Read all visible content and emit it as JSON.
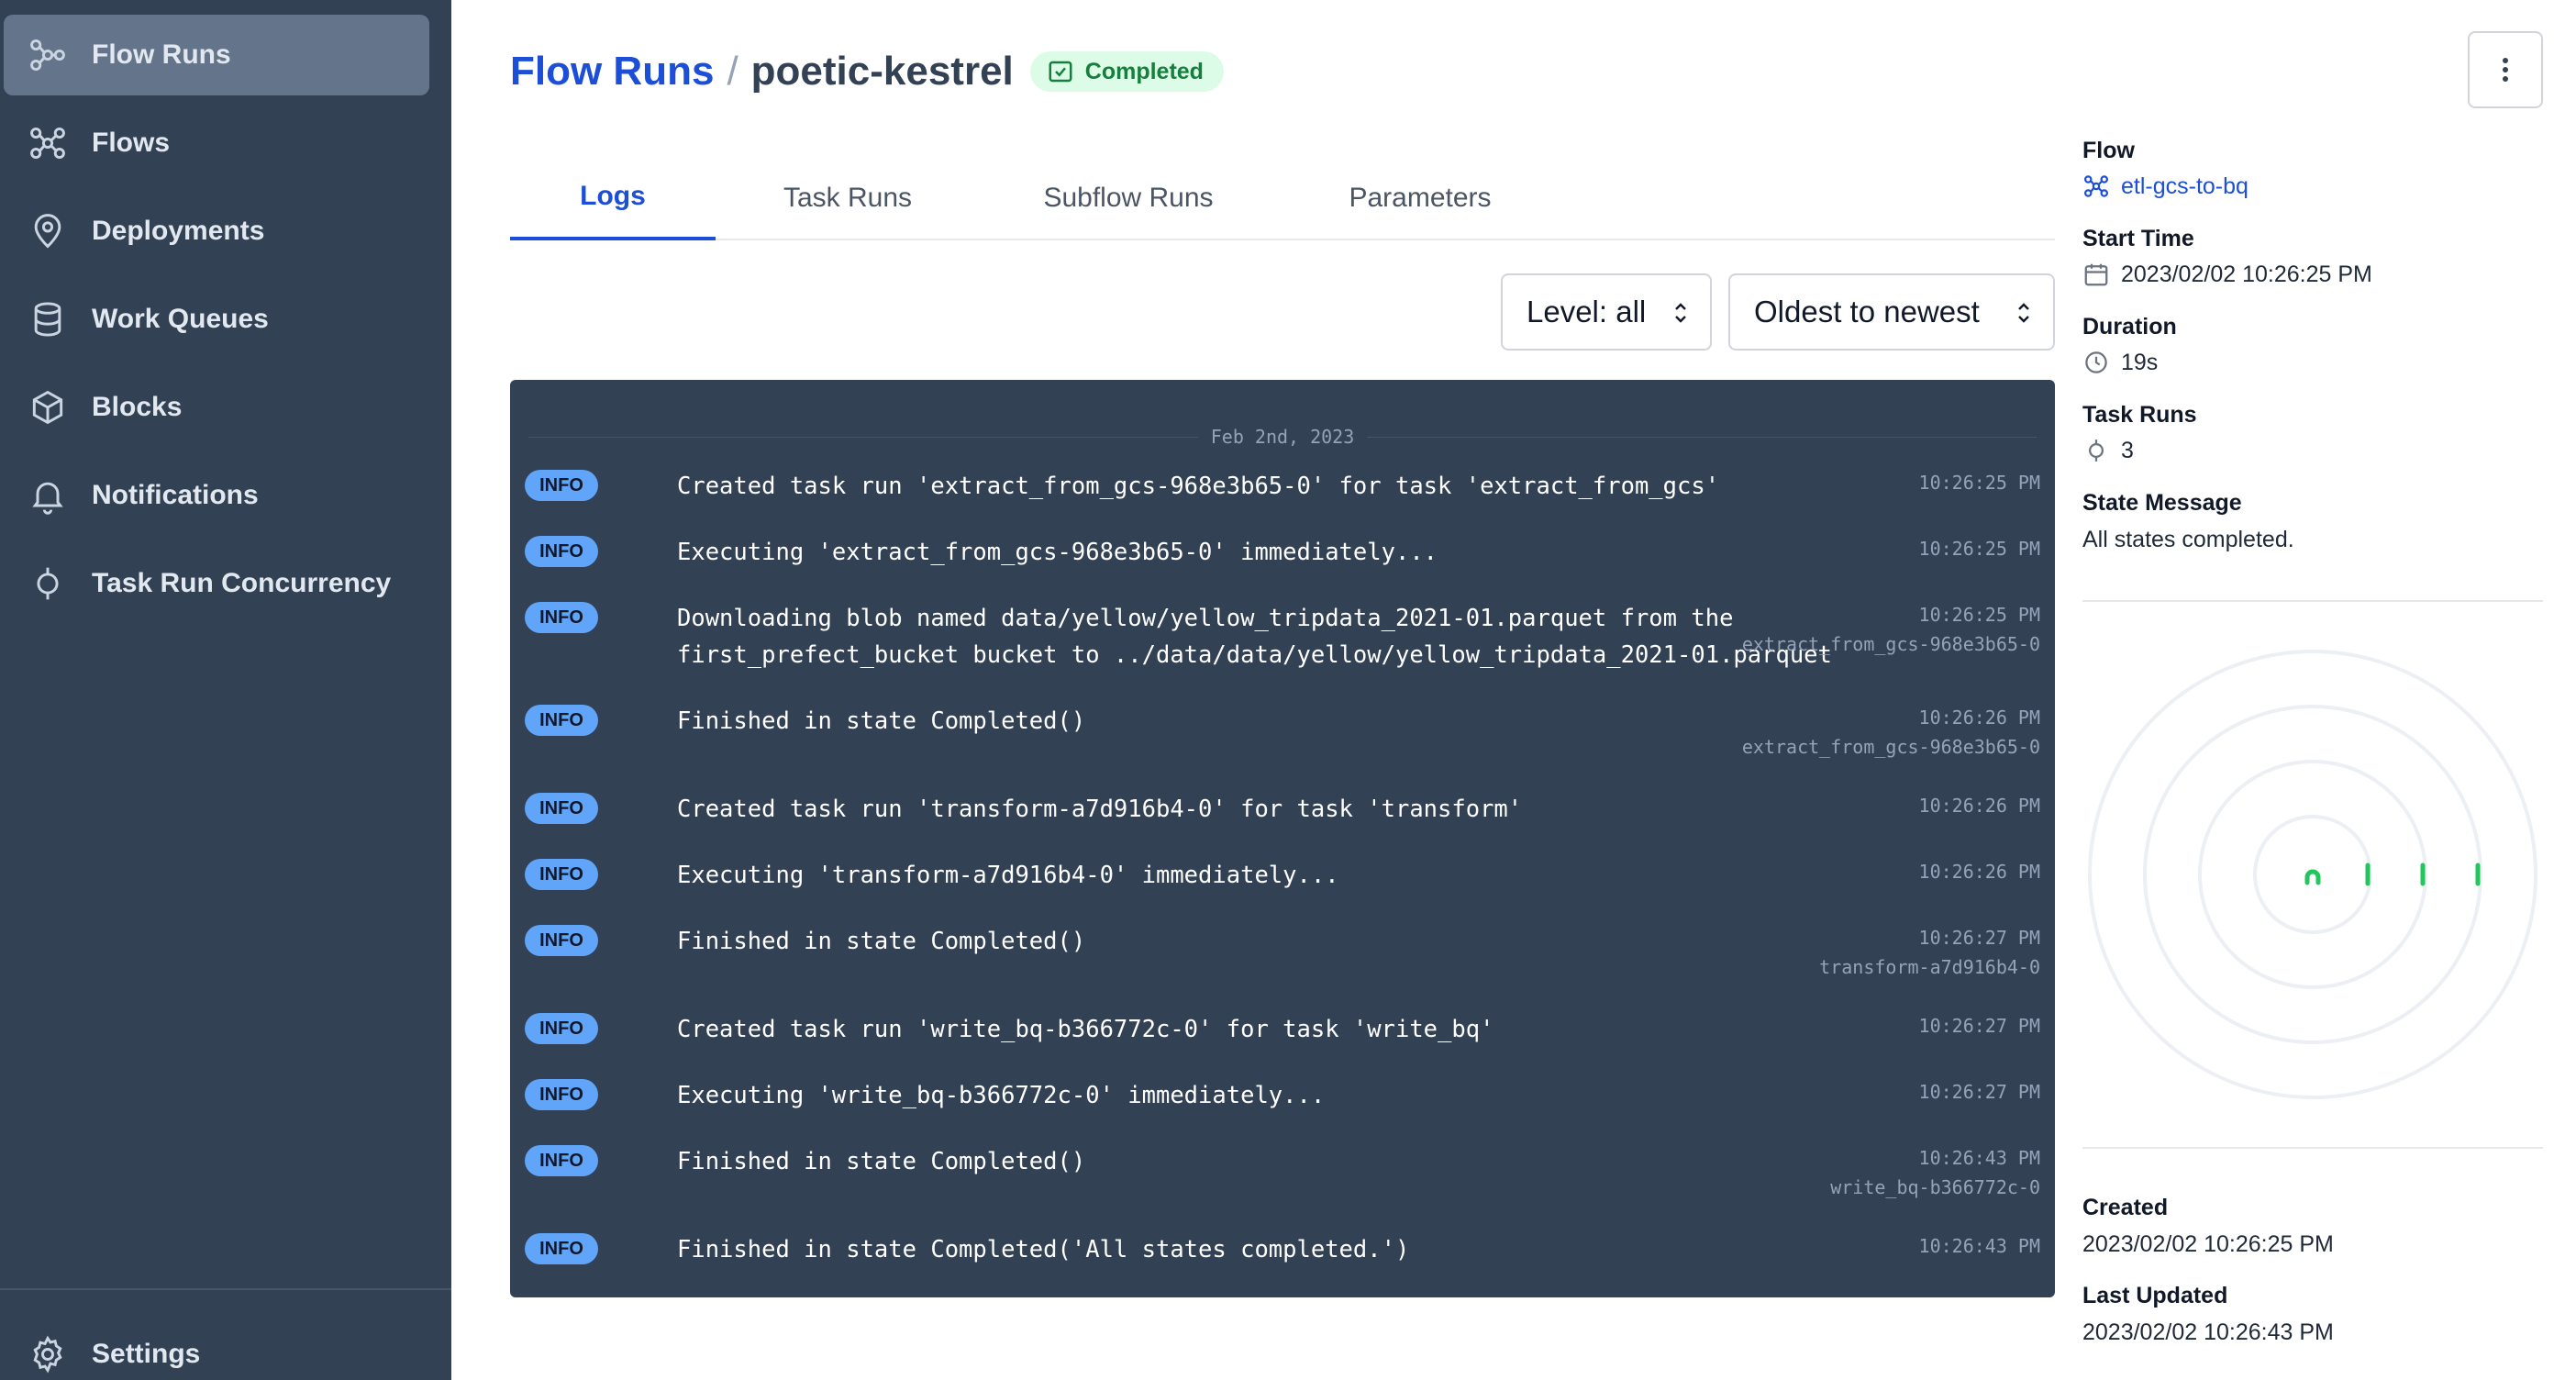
{
  "sidebar": {
    "items": [
      {
        "label": "Flow Runs",
        "icon": "flow-runs-icon",
        "active": true
      },
      {
        "label": "Flows",
        "icon": "flows-icon"
      },
      {
        "label": "Deployments",
        "icon": "map-pin-icon"
      },
      {
        "label": "Work Queues",
        "icon": "database-icon"
      },
      {
        "label": "Blocks",
        "icon": "cube-icon"
      },
      {
        "label": "Notifications",
        "icon": "bell-icon"
      },
      {
        "label": "Task Run Concurrency",
        "icon": "concurrency-icon"
      }
    ],
    "settings_label": "Settings"
  },
  "header": {
    "breadcrumb_root": "Flow Runs",
    "separator": "/",
    "run_name": "poetic-kestrel",
    "state_badge": "Completed"
  },
  "tabs": [
    "Logs",
    "Task Runs",
    "Subflow Runs",
    "Parameters"
  ],
  "filters": {
    "level": "Level: all",
    "sort": "Oldest to newest"
  },
  "logs": {
    "date": "Feb 2nd, 2023",
    "rows": [
      {
        "level": "INFO",
        "message": "Created task run 'extract_from_gcs-968e3b65-0' for task 'extract_from_gcs'",
        "time": "10:26:25 PM",
        "task": ""
      },
      {
        "level": "INFO",
        "message": "Executing 'extract_from_gcs-968e3b65-0' immediately...",
        "time": "10:26:25 PM",
        "task": ""
      },
      {
        "level": "INFO",
        "message": "Downloading blob named data/yellow/yellow_tripdata_2021-01.parquet from the\nfirst_prefect_bucket bucket to ../data/data/yellow/yellow_tripdata_2021-01.parquet",
        "time": "10:26:25 PM",
        "task": "extract_from_gcs-968e3b65-0"
      },
      {
        "level": "INFO",
        "message": "Finished in state Completed()",
        "time": "10:26:26 PM",
        "task": "extract_from_gcs-968e3b65-0"
      },
      {
        "level": "INFO",
        "message": "Created task run 'transform-a7d916b4-0' for task 'transform'",
        "time": "10:26:26 PM",
        "task": ""
      },
      {
        "level": "INFO",
        "message": "Executing 'transform-a7d916b4-0' immediately...",
        "time": "10:26:26 PM",
        "task": ""
      },
      {
        "level": "INFO",
        "message": "Finished in state Completed()",
        "time": "10:26:27 PM",
        "task": "transform-a7d916b4-0"
      },
      {
        "level": "INFO",
        "message": "Created task run 'write_bq-b366772c-0' for task 'write_bq'",
        "time": "10:26:27 PM",
        "task": ""
      },
      {
        "level": "INFO",
        "message": "Executing 'write_bq-b366772c-0' immediately...",
        "time": "10:26:27 PM",
        "task": ""
      },
      {
        "level": "INFO",
        "message": "Finished in state Completed()",
        "time": "10:26:43 PM",
        "task": "write_bq-b366772c-0"
      },
      {
        "level": "INFO",
        "message": "Finished in state Completed('All states completed.')",
        "time": "10:26:43 PM",
        "task": ""
      }
    ]
  },
  "details": {
    "flow_label": "Flow",
    "flow_value": "etl-gcs-to-bq",
    "start_time_label": "Start Time",
    "start_time_value": "2023/02/02 10:26:25 PM",
    "duration_label": "Duration",
    "duration_value": "19s",
    "task_runs_label": "Task Runs",
    "task_runs_value": "3",
    "state_message_label": "State Message",
    "state_message_value": "All states completed.",
    "created_label": "Created",
    "created_value": "2023/02/02 10:26:25 PM",
    "last_updated_label": "Last Updated",
    "last_updated_value": "2023/02/02 10:26:43 PM"
  },
  "colors": {
    "sidebar": "#334155",
    "accent": "#1d4ed8",
    "success": "#15803d",
    "info_badge": "#60a5fa"
  }
}
